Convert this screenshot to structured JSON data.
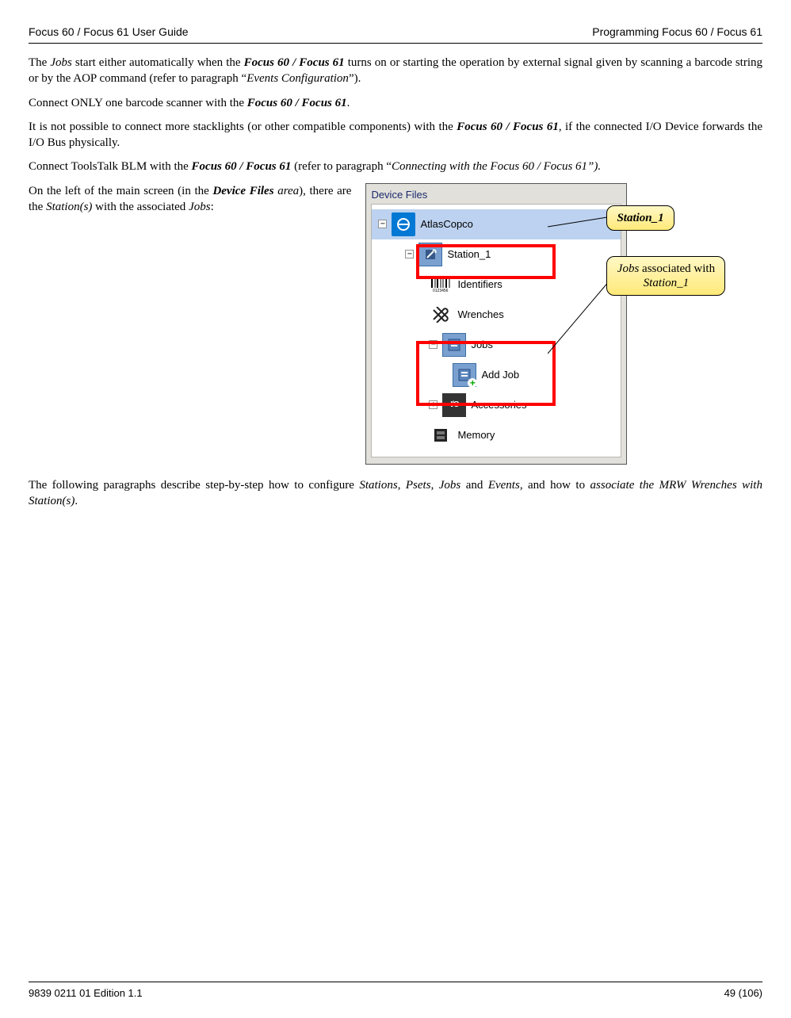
{
  "header": {
    "left": "Focus 60 / Focus 61 User Guide",
    "right": "Programming Focus 60 / Focus 61"
  },
  "paragraphs": {
    "p1_a": "The ",
    "p1_b": "Jobs",
    "p1_c": " start either automatically when the ",
    "p1_d": "Focus 60 / Focus 61",
    "p1_e": " turns on or starting the operation by external signal given by scanning a barcode string or by the AOP command (refer to paragraph “",
    "p1_f": "Events Configuration",
    "p1_g": "”).",
    "p2_a": "Connect ONLY one barcode scanner with the ",
    "p2_b": "Focus 60 / Focus 61",
    "p2_c": ".",
    "p3_a": "It is not possible to connect more stacklights (or other compatible components) with the ",
    "p3_b": "Focus 60 / Focus 61",
    "p3_c": ", if the connected I/O Device forwards the I/O Bus physically.",
    "p4_a": "Connect ToolsTalk BLM with the ",
    "p4_b": "Focus 60 / Focus 61",
    "p4_c": " (refer to paragraph “",
    "p4_d": "Connecting with the Focus 60 / Focus 61”).",
    "p5_a": "On the left of the main screen (in the ",
    "p5_b": "Device Files",
    "p5_c": " ",
    "p5_d": "area",
    "p5_e": "), there are the ",
    "p5_f": "Station(s)",
    "p5_g": " with the associated ",
    "p5_h": "Jobs",
    "p5_i": ":",
    "p6_a": "The following paragraphs describe step-by-step how to configure ",
    "p6_b": "Stations",
    "p6_c": ", ",
    "p6_d": "Psets",
    "p6_e": ", ",
    "p6_f": "Jobs",
    "p6_g": " and ",
    "p6_h": "Events",
    "p6_i": ", and how to ",
    "p6_j": "associate the MRW Wrenches with Station(s)",
    "p6_k": "."
  },
  "screenshot": {
    "title": "Device Files",
    "root": "AtlasCopco",
    "station": "Station_1",
    "identifiers": "Identifiers",
    "wrenches": "Wrenches",
    "jobs": "Jobs",
    "addjob": "Add Job",
    "accessories": "Accessories",
    "memory": "Memory"
  },
  "callouts": {
    "c1": "Station_1",
    "c2_a": "Jobs",
    "c2_b": " associated with ",
    "c2_c": "Station_1"
  },
  "footer": {
    "left": "9839 0211 01 Edition 1.1",
    "right": "49 (106)"
  }
}
